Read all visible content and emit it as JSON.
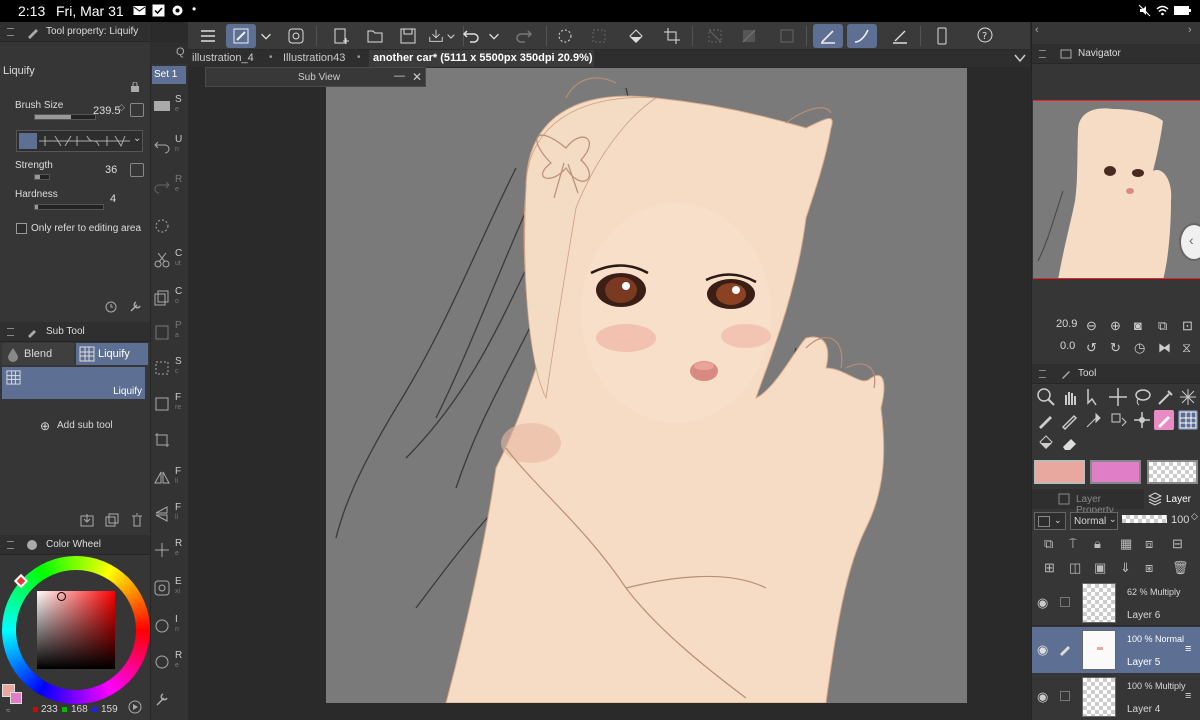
{
  "status_bar": {
    "time": "2:13",
    "date": "Fri, Mar 31"
  },
  "tool_property": {
    "header": "Tool property: Liquify",
    "tool_name": "Liquify",
    "brush_size_label": "Brush Size",
    "brush_size_value": "239.5",
    "strength_label": "Strength",
    "strength_value": "36",
    "hardness_label": "Hardness",
    "hardness_value": "4",
    "checkbox_label": "Only refer to editing area"
  },
  "sub_tool": {
    "header": "Sub Tool",
    "tab_blend": "Blend",
    "tab_liquify": "Liquify",
    "selected_item": "Liquify",
    "add_label": "Add sub tool"
  },
  "color_wheel": {
    "header": "Color Wheel",
    "r": "233",
    "g": "168",
    "b": "159",
    "main_color": "#e9a89f"
  },
  "set_tab": "Set 1",
  "tabs": [
    "illustration_4",
    "Illustration43",
    "another car* (5111 x 5500px 350dpi 20.9%)"
  ],
  "sub_view": {
    "title": "Sub View"
  },
  "navigator": {
    "header": "Navigator",
    "zoom": "20.9",
    "rotation": "0.0"
  },
  "tool_panel": {
    "header": "Tool",
    "colors": [
      "#e9a89f",
      "#e07fc8"
    ]
  },
  "layers": {
    "tab_property": "Layer Property",
    "tab_layer": "Layer",
    "blend_mode": "Normal",
    "opacity": "100",
    "items": [
      {
        "name": "Layer 6",
        "mode": "62 % Multiply"
      },
      {
        "name": "Layer 5",
        "mode": "100 % Normal"
      },
      {
        "name": "Layer 4",
        "mode": "100 % Multiply"
      }
    ]
  }
}
